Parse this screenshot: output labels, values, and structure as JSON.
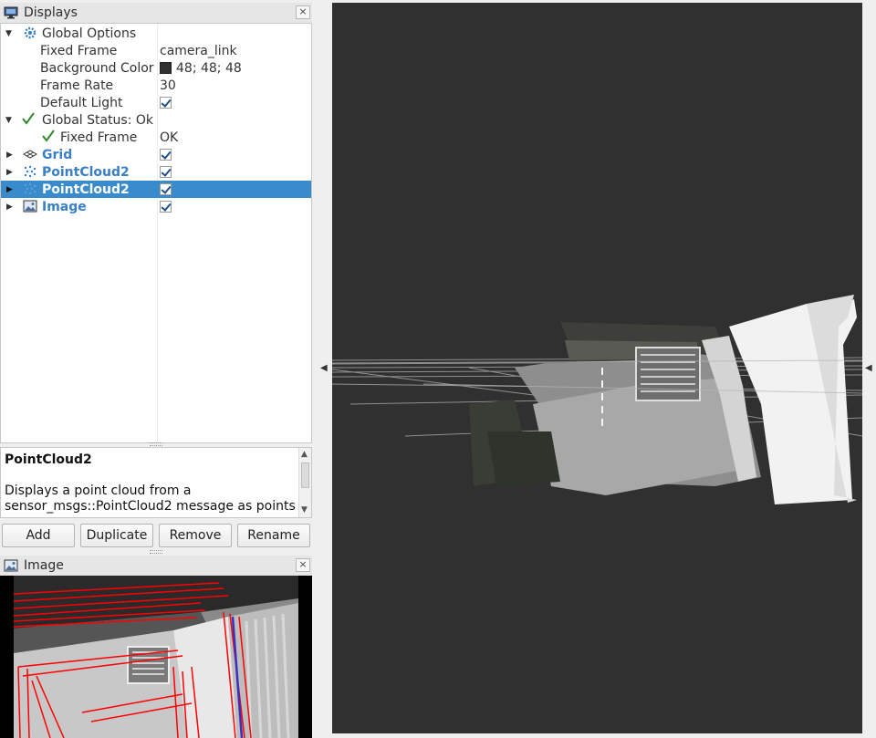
{
  "displays_panel": {
    "title": "Displays",
    "close_label": "×",
    "rows": [
      {
        "label": "Global Options",
        "value": ""
      },
      {
        "label": "Fixed Frame",
        "value": "camera_link"
      },
      {
        "label": "Background Color",
        "value": "48; 48; 48"
      },
      {
        "label": "Frame Rate",
        "value": "30"
      },
      {
        "label": "Default Light",
        "value": ""
      },
      {
        "label": "Global Status: Ok",
        "value": ""
      },
      {
        "label": "Fixed Frame",
        "value": "OK"
      },
      {
        "label": "Grid",
        "value": ""
      },
      {
        "label": "PointCloud2",
        "value": ""
      },
      {
        "label": "PointCloud2",
        "value": ""
      },
      {
        "label": "Image",
        "value": ""
      }
    ]
  },
  "description": {
    "title": "PointCloud2",
    "text": "Displays a point cloud from a sensor_msgs::PointCloud2 message as points"
  },
  "buttons": {
    "add": "Add",
    "duplicate": "Duplicate",
    "remove": "Remove",
    "rename": "Rename"
  },
  "image_panel": {
    "title": "Image",
    "close_label": "×"
  },
  "colors": {
    "selection": "#3a8bcb",
    "display_link": "#3a7fc6",
    "render_background": "#303030",
    "overlay_lines": "#ff0000"
  }
}
